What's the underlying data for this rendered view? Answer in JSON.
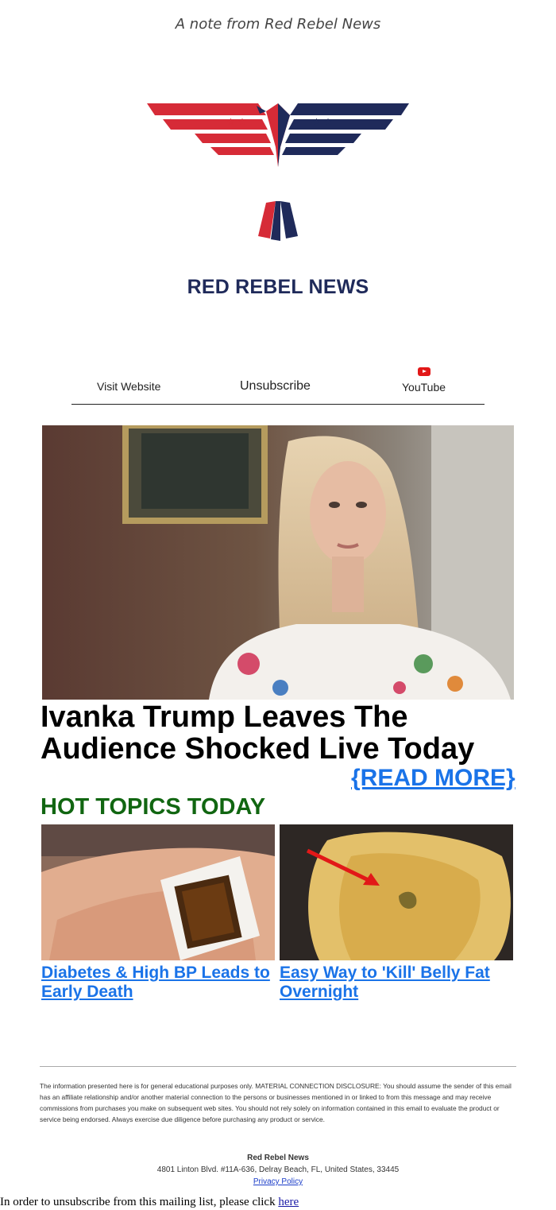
{
  "header": {
    "note": "A note from Red Rebel News"
  },
  "logo": {
    "text": "RED REBEL NEWS",
    "colors": {
      "red": "#d62b37",
      "navy": "#1f2a5a"
    }
  },
  "nav": {
    "visit_website": "Visit Website",
    "unsubscribe": "Unsubscribe",
    "youtube": "YouTube",
    "youtube_icon": "youtube-play-icon"
  },
  "hero": {
    "title": "Ivanka Trump Leaves The Audience Shocked Live Today",
    "read_more": "{READ MORE}"
  },
  "hot_topics": {
    "heading": "HOT TOPICS TODAY",
    "items": [
      {
        "title": "Diabetes & High BP Leads to Early Death"
      },
      {
        "title": "Easy Way to 'Kill' Belly Fat Overnight"
      }
    ]
  },
  "disclaimer": "The information presented here is for general educational purposes only. MATERIAL CONNECTION DISCLOSURE: You should assume the sender of this email has an affiliate relationship and/or another material connection to the persons or businesses mentioned in or linked to from this message and may receive commissions from purchases you make on subsequent web sites. You should not rely solely on information contained in this email to evaluate the product or service being endorsed. Always exercise due diligence before purchasing any product or service.",
  "footer": {
    "company": "Red Rebel News",
    "address": "4801 Linton Blvd. #11A-636, Delray Beach, FL, United States, 33445",
    "privacy": "Privacy Policy"
  },
  "unsubscribe_line": {
    "text": "In order to unsubscribe from this mailing list, please click ",
    "link": "here"
  },
  "colors": {
    "link_blue": "#1a73e8",
    "hot_green": "#116611"
  }
}
